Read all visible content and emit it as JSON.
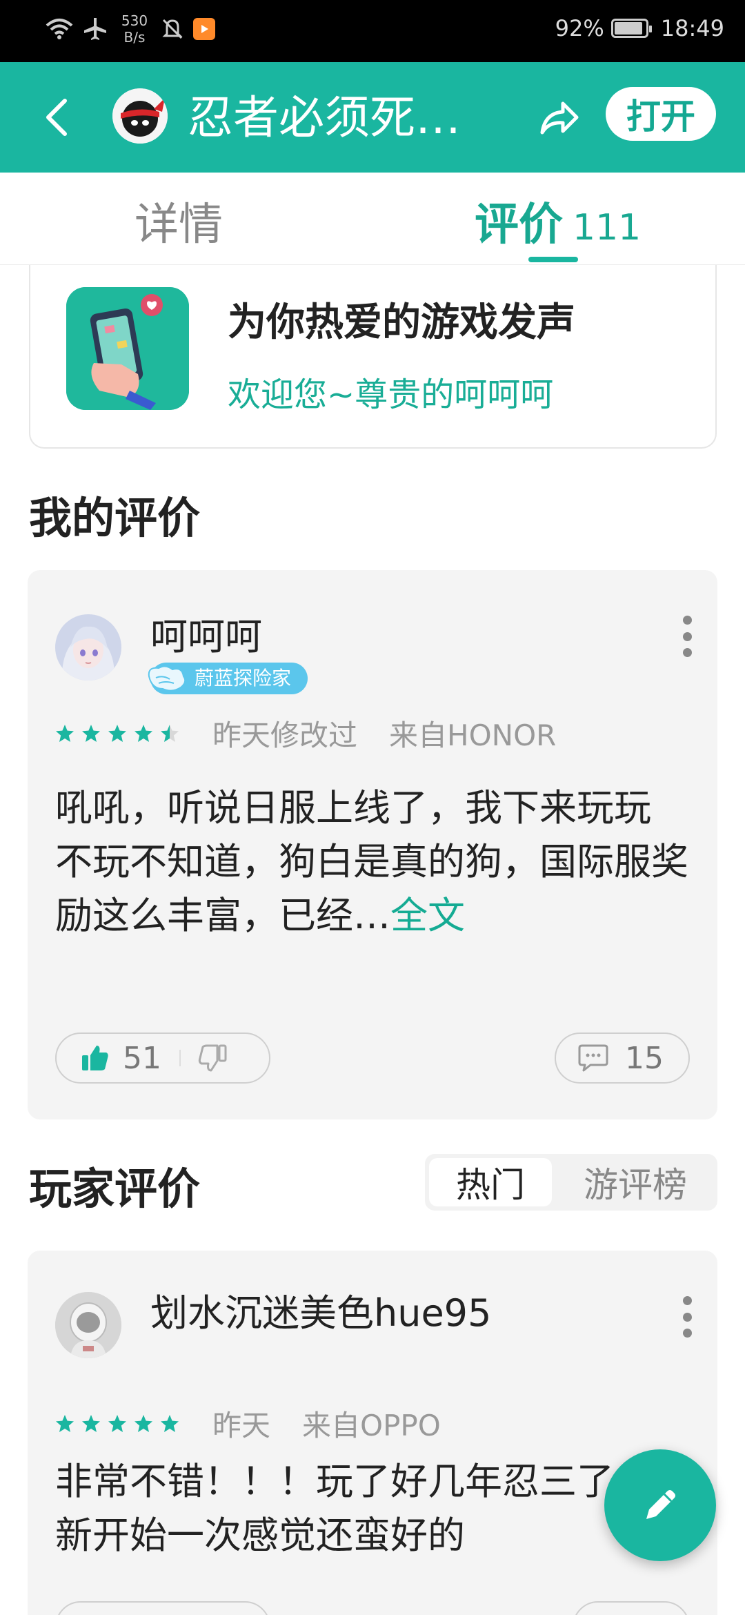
{
  "status_bar": {
    "net_speed_value": "530",
    "net_speed_unit": "B/s",
    "battery": "92%",
    "battery_level": 0.92,
    "time": "18:49"
  },
  "header": {
    "title": "忍者必须死…",
    "open_label": "打开"
  },
  "tabs": {
    "details": "详情",
    "reviews": "评价",
    "reviews_count": "111"
  },
  "promo": {
    "headline": "为你热爱的游戏发声",
    "subtitle": "欢迎您~尊贵的呵呵呵"
  },
  "my_review": {
    "section_title": "我的评价",
    "username": "呵呵呵",
    "badge": "蔚蓝探险家",
    "rating": 4.5,
    "time": "昨天修改过",
    "source": "来自HONOR",
    "body": "吼吼，听说日服上线了，我下来玩玩\n不玩不知道，狗白是真的狗，国际服奖励这么丰富，已经…",
    "more": "全文",
    "likes": "51",
    "comments": "15"
  },
  "player_reviews": {
    "section_title": "玩家评价",
    "sort_hot": "热门",
    "sort_rank": "游评榜",
    "items": [
      {
        "username": "划水沉迷美色hue95",
        "rating": 5,
        "time": "昨天",
        "source": "来自OPPO",
        "body": "非常不错！！！玩了好几年忍三了，重新开始一次感觉还蛮好的"
      }
    ]
  },
  "colors": {
    "accent": "#1ab6a0",
    "status_bar": "#000000"
  }
}
